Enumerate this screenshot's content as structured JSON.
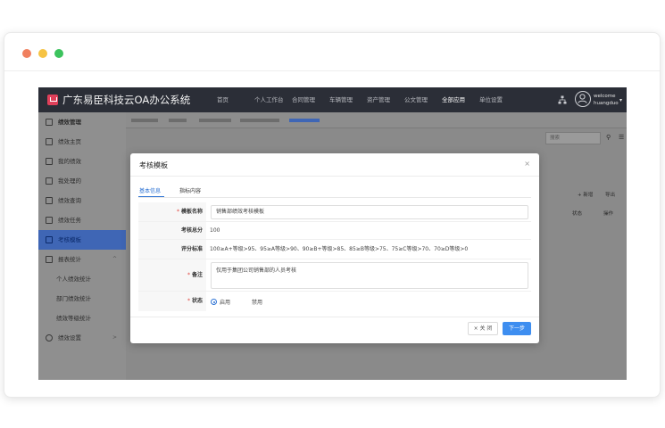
{
  "app": {
    "title": "广东易臣科技云OA办公系统",
    "nav": [
      "首页",
      "个人工作台",
      "合同管理",
      "车辆管理",
      "资产管理",
      "公文管理",
      "全部应用",
      "单位设置"
    ],
    "nav_active_index": 6,
    "user": {
      "greeting": "welcome",
      "name": "huangduo"
    }
  },
  "sidebar": {
    "header": "绩效管理",
    "items": [
      {
        "label": "绩效主页",
        "icon": "home-icon"
      },
      {
        "label": "我的绩效",
        "icon": "chart-icon"
      },
      {
        "label": "我处理的",
        "icon": "task-icon"
      },
      {
        "label": "绩效查询",
        "icon": "search-doc-icon"
      },
      {
        "label": "绩效任务",
        "icon": "list-icon"
      },
      {
        "label": "考核模板",
        "icon": "template-icon",
        "active": true
      },
      {
        "label": "报表统计",
        "icon": "report-icon"
      },
      {
        "label": "个人绩效统计",
        "sub": true
      },
      {
        "label": "部门绩效统计",
        "sub": true
      },
      {
        "label": "绩效等级统计",
        "sub": true
      },
      {
        "label": "绩效设置",
        "icon": "gear-icon"
      }
    ]
  },
  "background": {
    "search_placeholder": "搜索",
    "add_label": "+ 新增",
    "export_label": "导出",
    "col_status": "状态",
    "col_action": "操作"
  },
  "modal": {
    "title": "考核模板",
    "close_symbol": "×",
    "tabs": [
      "基本信息",
      "指标内容"
    ],
    "active_tab": 0,
    "fields": {
      "template_name_label": "模板名称",
      "template_name_value": "销售部绩效考核模板",
      "total_score_label": "考核总分",
      "total_score_value": "100",
      "criteria_label": "评分标准",
      "criteria_value": "100≥A+等级>95、95≥A等级>90、90≥B+等级>85、85≥B等级>75、75≥C等级>70、70≥D等级>0",
      "remark_label": "备注",
      "remark_value": "仅用于集团公司销售部的人员考核",
      "status_label": "状态",
      "status_options": [
        "启用",
        "禁用"
      ],
      "status_selected": "启用"
    },
    "buttons": {
      "close": "× 关 闭",
      "next": "下一步"
    }
  },
  "colors": {
    "accent": "#3e8ef0",
    "topbar": "#2b2e37",
    "required": "#e0403a"
  }
}
